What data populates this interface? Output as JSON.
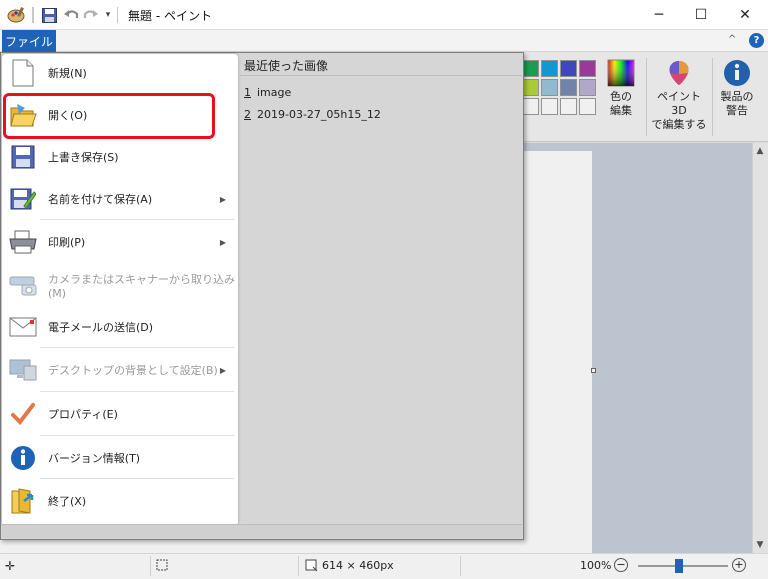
{
  "titlebar": {
    "title": "無題 - ペイント",
    "minimize": "─",
    "maximize": "☐",
    "close": "✕"
  },
  "ribbon": {
    "file_tab": "ファイル",
    "collapse": "^",
    "help": "?",
    "edit_colors": [
      "色の",
      "編集"
    ],
    "paint3d": [
      "ペイント 3D",
      "で編集する"
    ],
    "product_alert": [
      "製品の",
      "警告"
    ],
    "palette": [
      "#19a454",
      "#0ea0e0",
      "#3e48c6",
      "#a13aa0",
      "#b4d736",
      "#97c6dc",
      "#7589b5",
      "#bab0d6"
    ]
  },
  "file_menu": {
    "items": [
      {
        "label": "新規(N)",
        "key": "new",
        "icon": "new-doc-icon",
        "disabled": false,
        "submenu": false
      },
      {
        "label": "開く(O)",
        "key": "open",
        "icon": "open-folder-icon",
        "disabled": false,
        "submenu": false
      },
      {
        "label": "上書き保存(S)",
        "key": "save",
        "icon": "save-disk-icon",
        "disabled": false,
        "submenu": false
      },
      {
        "label": "名前を付けて保存(A)",
        "key": "save-as",
        "icon": "save-as-icon",
        "disabled": false,
        "submenu": true
      },
      {
        "label": "印刷(P)",
        "key": "print",
        "icon": "printer-icon",
        "disabled": false,
        "submenu": true
      },
      {
        "label": "カメラまたはスキャナーから取り込み(M)",
        "key": "scanner",
        "icon": "scanner-icon",
        "disabled": true,
        "submenu": false
      },
      {
        "label": "電子メールの送信(D)",
        "key": "email",
        "icon": "envelope-icon",
        "disabled": false,
        "submenu": false
      },
      {
        "label": "デスクトップの背景として設定(B)",
        "key": "desktop",
        "icon": "desktop-icon",
        "disabled": true,
        "submenu": true
      },
      {
        "label": "プロパティ(E)",
        "key": "properties",
        "icon": "checkmark-icon",
        "disabled": false,
        "submenu": false
      },
      {
        "label": "バージョン情報(T)",
        "key": "about",
        "icon": "info-icon",
        "disabled": false,
        "submenu": false
      },
      {
        "label": "終了(X)",
        "key": "exit",
        "icon": "exit-icon",
        "disabled": false,
        "submenu": false
      }
    ],
    "recent_header": "最近使った画像",
    "recent": [
      {
        "num": "1",
        "name": "image"
      },
      {
        "num": "2",
        "name": "2019-03-27_05h15_12"
      }
    ]
  },
  "statusbar": {
    "dimensions": "614 × 460px",
    "zoom": "100%",
    "zoom_fraction": 0.45
  }
}
